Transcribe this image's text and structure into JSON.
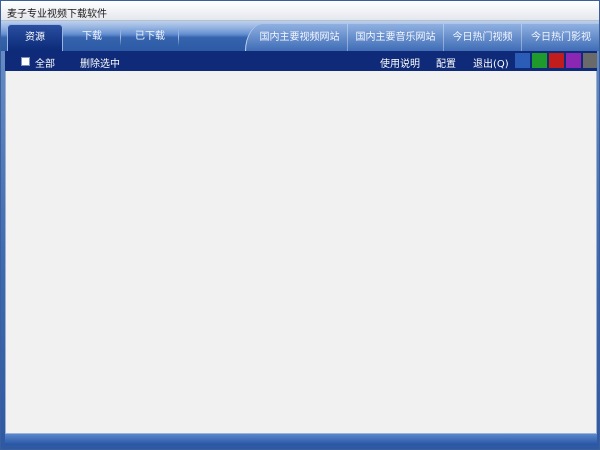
{
  "window": {
    "title": "麦子专业视频下载软件"
  },
  "tabs": [
    {
      "label": "资源",
      "active": true
    },
    {
      "label": "下载",
      "active": false
    },
    {
      "label": "已下载",
      "active": false
    }
  ],
  "right_tabs": [
    {
      "label": "国内主要视频网站"
    },
    {
      "label": "国内主要音乐网站"
    },
    {
      "label": "今日热门视频"
    },
    {
      "label": "今日热门影视"
    }
  ],
  "toolbar": {
    "select_all_label": "全部",
    "select_all_checked": false,
    "delete_selected_label": "删除选中",
    "help_label": "使用说明",
    "config_label": "配置",
    "exit_label": "退出(Q)"
  },
  "theme_colors": [
    {
      "name": "blue",
      "hex": "#2b5cb8"
    },
    {
      "name": "green",
      "hex": "#1f9a2c"
    },
    {
      "name": "red",
      "hex": "#c21d1d"
    },
    {
      "name": "purple",
      "hex": "#8b27b3"
    },
    {
      "name": "gray",
      "hex": "#6a6a6a"
    }
  ]
}
